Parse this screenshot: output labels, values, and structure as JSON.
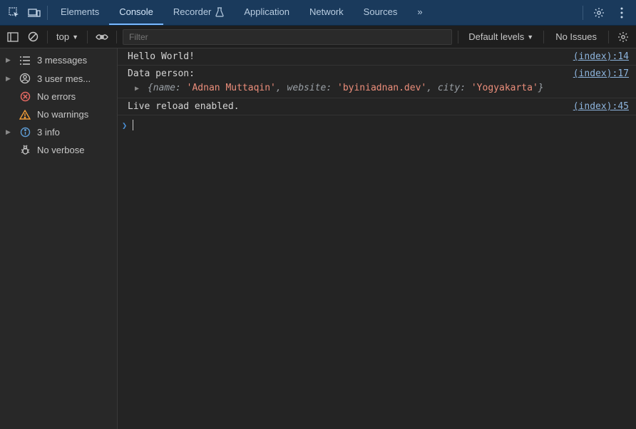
{
  "tabs": {
    "elements": "Elements",
    "console": "Console",
    "recorder": "Recorder",
    "application": "Application",
    "network": "Network",
    "sources": "Sources",
    "more": "»"
  },
  "toolbar": {
    "context": "top",
    "filter_placeholder": "Filter",
    "levels": "Default levels",
    "no_issues": "No Issues"
  },
  "sidebar": {
    "messages": "3 messages",
    "user_messages": "3 user mes...",
    "no_errors": "No errors",
    "no_warnings": "No warnings",
    "info": "3 info",
    "no_verbose": "No verbose"
  },
  "logs": {
    "hello": "Hello World!",
    "hello_src": "(index):14",
    "data_label": "Data person:",
    "data_src": "(index):17",
    "obj_name_key": "name",
    "obj_name_val": "'Adnan Muttaqin'",
    "obj_website_key": "website",
    "obj_website_val": "'byiniadnan.dev'",
    "obj_city_key": "city",
    "obj_city_val": "'Yogyakarta'",
    "live": "Live reload enabled.",
    "live_src": "(index):45"
  }
}
